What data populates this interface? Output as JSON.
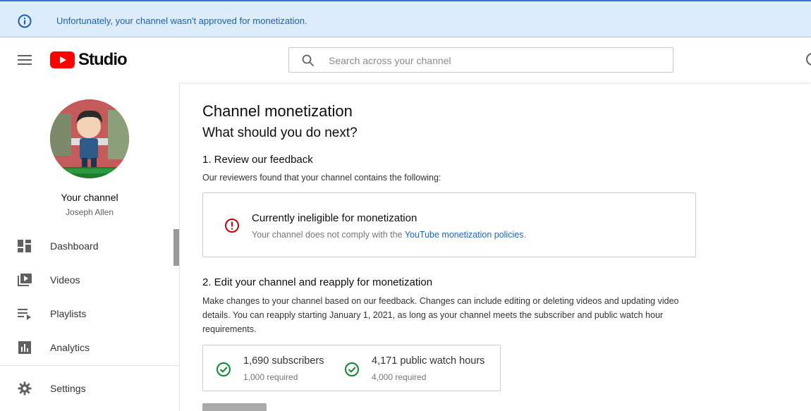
{
  "banner": {
    "icon": "info-icon",
    "message": "Unfortunately, your channel wasn't approved for monetization."
  },
  "header": {
    "logo_text": "Studio",
    "search_placeholder": "Search across your channel"
  },
  "sidebar": {
    "channel_label": "Your channel",
    "channel_name": "Joseph Allen",
    "items": [
      {
        "label": "Dashboard",
        "icon": "dashboard-icon"
      },
      {
        "label": "Videos",
        "icon": "videos-icon"
      },
      {
        "label": "Playlists",
        "icon": "playlists-icon"
      },
      {
        "label": "Analytics",
        "icon": "analytics-icon"
      },
      {
        "label": "Settings",
        "icon": "gear-icon"
      }
    ]
  },
  "main": {
    "title": "Channel monetization",
    "subtitle": "What should you do next?",
    "section1": {
      "heading": "1. Review our feedback",
      "description": "Our reviewers found that your channel contains the following:",
      "card_title": "Currently ineligible for monetization",
      "card_text": "Your channel does not comply with the ",
      "card_link": "YouTube monetization policies",
      "card_text_end": "."
    },
    "section2": {
      "heading": "2. Edit your channel and reapply for monetization",
      "description": "Make changes to your channel based on our feedback. Changes can include editing or deleting videos and updating video details. You can reapply starting January 1, 2021, as long as your channel meets the subscriber and public watch hour requirements."
    },
    "requirements": [
      {
        "value": "1,690 subscribers",
        "required": "1,000 required"
      },
      {
        "value": "4,171 public watch hours",
        "required": "4,000 required"
      }
    ]
  },
  "colors": {
    "banner_bg": "#dcecfa",
    "link": "#1a65c8",
    "error": "#cc0000",
    "success": "#0a8a2a",
    "youtube_red": "#ff0000"
  }
}
